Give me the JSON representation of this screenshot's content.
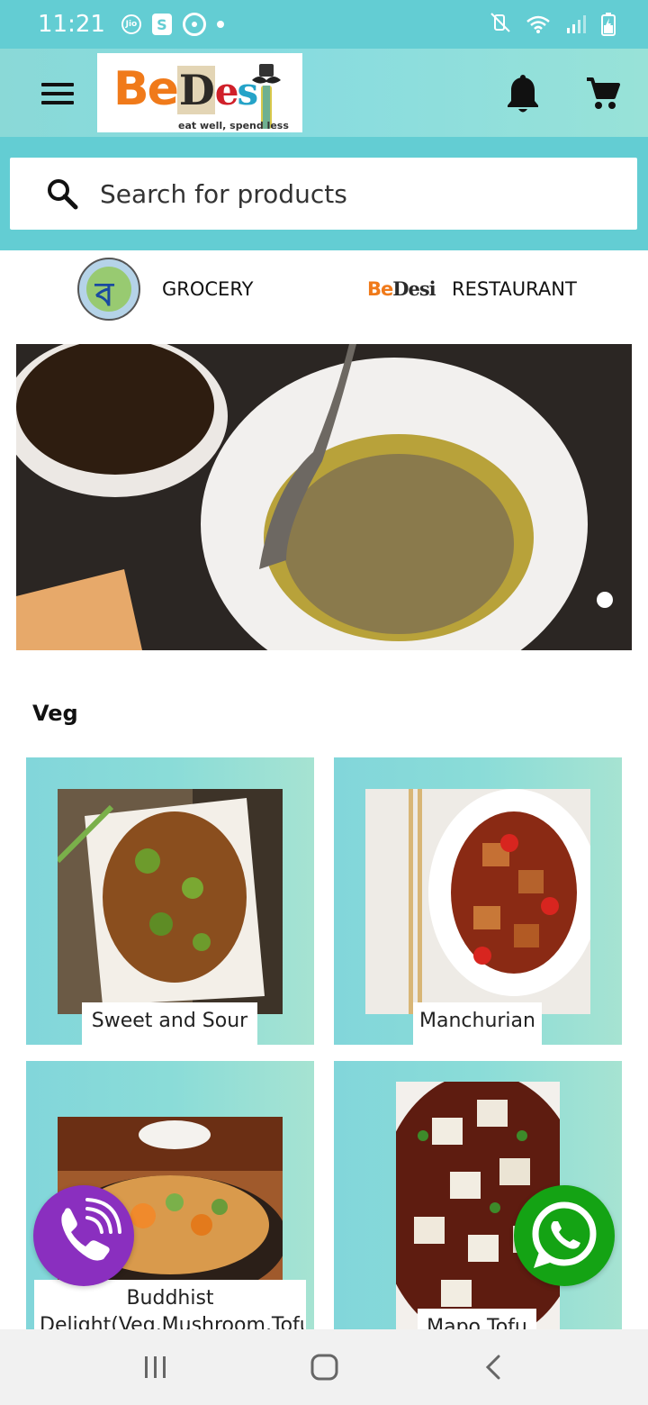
{
  "status_bar": {
    "time": "11:21",
    "notification_icons": [
      "jio-icon",
      "shopify-bag-icon",
      "fan-icon",
      "dot-icon"
    ],
    "right_icons": [
      "vibrate-mute-icon",
      "wifi-icon",
      "signal-icon",
      "battery-icon"
    ],
    "jio_label": "Jio",
    "bag_label": "S"
  },
  "app_bar": {
    "logo_tagline": "eat well, spend less",
    "logo_be": "Be",
    "logo_d": "D",
    "logo_e": "e",
    "logo_s": "s",
    "menu_icon": "menu-icon",
    "bell_icon": "bell-icon",
    "cart_icon": "cart-icon"
  },
  "search": {
    "placeholder": "Search for products"
  },
  "categories": [
    {
      "label": "GROCERY",
      "icon": "grocery-logo"
    },
    {
      "label": "RESTAURANT",
      "icon": "bedesi-logo"
    }
  ],
  "category_logo": {
    "grocery_glyph": "ব",
    "mini_be": "Be",
    "mini_ds": "Desi"
  },
  "banner": {
    "pages": 1,
    "active_page": 1
  },
  "section": {
    "title": "Veg"
  },
  "products": [
    {
      "name": "Sweet and Sour"
    },
    {
      "name": "Manchurian"
    },
    {
      "name": "Buddhist Delight(Veg,Mushroom,Tofu)"
    },
    {
      "name": "Mapo Tofu"
    }
  ],
  "floating_buttons": [
    {
      "name": "call",
      "color": "#8a2fbf"
    },
    {
      "name": "whatsapp",
      "color": "#14a314"
    }
  ],
  "colors": {
    "accent": "#63cdd3",
    "app_bar": "#8ad9d7",
    "card": "#86dbd9"
  }
}
